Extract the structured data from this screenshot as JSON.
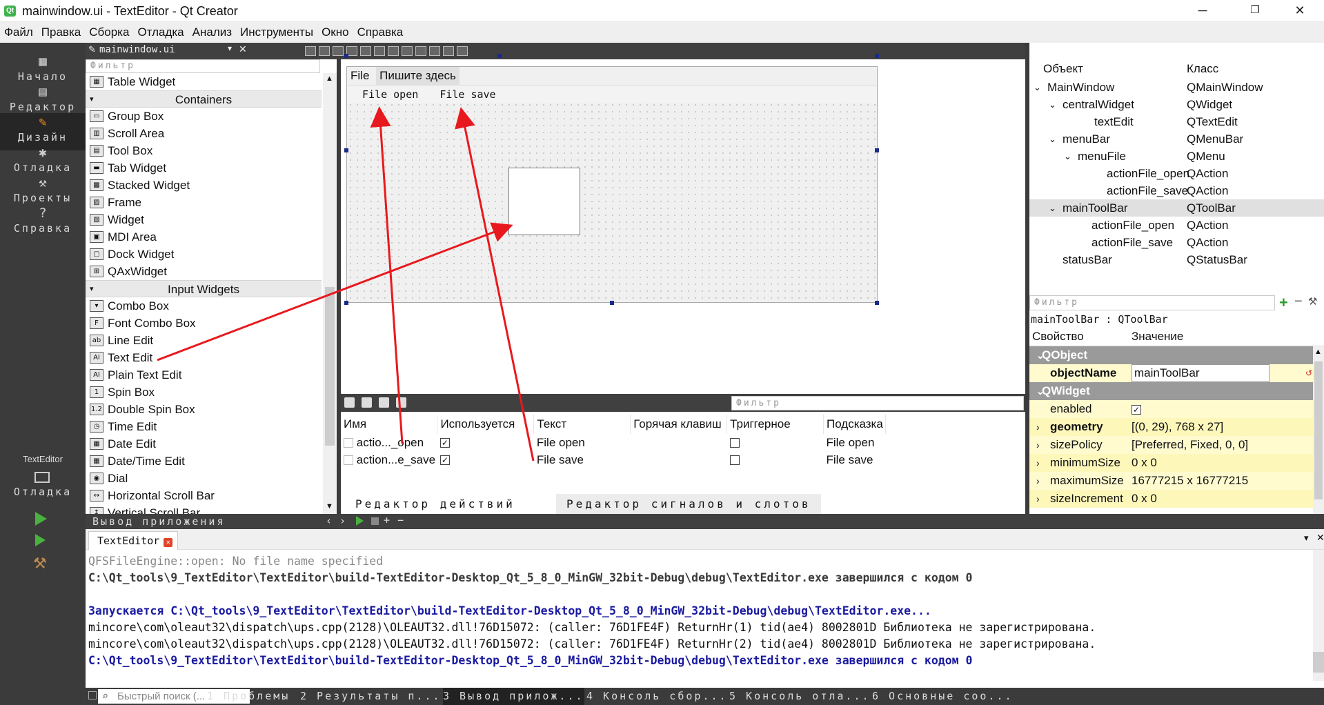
{
  "window": {
    "title": "mainwindow.ui - TextEditor - Qt Creator",
    "logo": "Qt",
    "minimize": "─",
    "maximize": "❐",
    "close": "✕"
  },
  "menubar": [
    "Файл",
    "Правка",
    "Сборка",
    "Отладка",
    "Анализ",
    "Инструменты",
    "Окно",
    "Справка"
  ],
  "modes": [
    {
      "label": "Начало",
      "icon": "grid-icon",
      "glyph": "▦"
    },
    {
      "label": "Редактор",
      "icon": "editor-icon",
      "glyph": "▤"
    },
    {
      "label": "Дизайн",
      "icon": "pencil-icon",
      "glyph": "✎",
      "active": true
    },
    {
      "label": "Отладка",
      "icon": "bug-icon",
      "glyph": "✱"
    },
    {
      "label": "Проекты",
      "icon": "wrench-icon",
      "glyph": "⚒"
    },
    {
      "label": "Справка",
      "icon": "help-icon",
      "glyph": "?"
    }
  ],
  "kit": {
    "project": "TextEditor",
    "mode": "Отладка"
  },
  "editor_tab": {
    "file": "mainwindow.ui"
  },
  "widgetbox": {
    "filter_placeholder": "Фильтр",
    "items": [
      {
        "type": "item",
        "label": "Table Widget",
        "glyph": "▦"
      },
      {
        "type": "cat",
        "label": "Containers"
      },
      {
        "type": "item",
        "label": "Group Box",
        "glyph": "▭"
      },
      {
        "type": "item",
        "label": "Scroll Area",
        "glyph": "▥"
      },
      {
        "type": "item",
        "label": "Tool Box",
        "glyph": "▤"
      },
      {
        "type": "item",
        "label": "Tab Widget",
        "glyph": "▬"
      },
      {
        "type": "item",
        "label": "Stacked Widget",
        "glyph": "▩"
      },
      {
        "type": "item",
        "label": "Frame",
        "glyph": "▨"
      },
      {
        "type": "item",
        "label": "Widget",
        "glyph": "▧"
      },
      {
        "type": "item",
        "label": "MDI Area",
        "glyph": "▣"
      },
      {
        "type": "item",
        "label": "Dock Widget",
        "glyph": "▢"
      },
      {
        "type": "item",
        "label": "QAxWidget",
        "glyph": "⊞"
      },
      {
        "type": "cat",
        "label": "Input Widgets"
      },
      {
        "type": "item",
        "label": "Combo Box",
        "glyph": "▾"
      },
      {
        "type": "item",
        "label": "Font Combo Box",
        "glyph": "F"
      },
      {
        "type": "item",
        "label": "Line Edit",
        "glyph": "ab"
      },
      {
        "type": "item",
        "label": "Text Edit",
        "glyph": "AI"
      },
      {
        "type": "item",
        "label": "Plain Text Edit",
        "glyph": "AI"
      },
      {
        "type": "item",
        "label": "Spin Box",
        "glyph": "1"
      },
      {
        "type": "item",
        "label": "Double Spin Box",
        "glyph": "1.2"
      },
      {
        "type": "item",
        "label": "Time Edit",
        "glyph": "◷"
      },
      {
        "type": "item",
        "label": "Date Edit",
        "glyph": "▦"
      },
      {
        "type": "item",
        "label": "Date/Time Edit",
        "glyph": "▦"
      },
      {
        "type": "item",
        "label": "Dial",
        "glyph": "◉"
      },
      {
        "type": "item",
        "label": "Horizontal Scroll Bar",
        "glyph": "↔"
      },
      {
        "type": "item",
        "label": "Vertical Scroll Bar",
        "glyph": "↕"
      }
    ]
  },
  "form": {
    "menu": [
      "File",
      "Пишите здесь"
    ],
    "toolbar": [
      "File open",
      "File save"
    ]
  },
  "action_editor": {
    "filter_placeholder": "Фильтр",
    "columns": [
      "Имя",
      "Используется",
      "Текст",
      "Горячая клавиш",
      "Триггерное",
      "Подсказка"
    ],
    "rows": [
      {
        "name": "actio..._open",
        "used": "✓",
        "text": "File open",
        "shortcut": "",
        "tooltip": "File open"
      },
      {
        "name": "action...e_save",
        "used": "✓",
        "text": "File save",
        "shortcut": "",
        "tooltip": "File save"
      }
    ],
    "tabs": [
      "Редактор действий",
      "Редактор сигналов и слотов"
    ]
  },
  "object_inspector": {
    "headers": [
      "Объект",
      "Класс"
    ],
    "rows": [
      {
        "obj": "MainWindow",
        "cls": "QMainWindow",
        "arrow": "⌄"
      },
      {
        "obj": "centralWidget",
        "cls": "QWidget",
        "arrow": "⌄"
      },
      {
        "obj": "textEdit",
        "cls": "QTextEdit",
        "arrow": ""
      },
      {
        "obj": "menuBar",
        "cls": "QMenuBar",
        "arrow": "⌄"
      },
      {
        "obj": "menuFile",
        "cls": "QMenu",
        "arrow": "⌄"
      },
      {
        "obj": "actionFile_open",
        "cls": "QAction",
        "arrow": ""
      },
      {
        "obj": "actionFile_save",
        "cls": "QAction",
        "arrow": ""
      },
      {
        "obj": "mainToolBar",
        "cls": "QToolBar",
        "arrow": "⌄",
        "selected": true
      },
      {
        "obj": "actionFile_open",
        "cls": "QAction",
        "arrow": ""
      },
      {
        "obj": "actionFile_save",
        "cls": "QAction",
        "arrow": ""
      },
      {
        "obj": "statusBar",
        "cls": "QStatusBar",
        "arrow": ""
      }
    ]
  },
  "property_editor": {
    "filter_placeholder": "Фильтр",
    "plus": "+",
    "minus": "−",
    "info": "mainToolBar : QToolBar",
    "headers": [
      "Свойство",
      "Значение"
    ],
    "rows": [
      {
        "kind": "grp",
        "name": "QObject",
        "arrow": "⌄"
      },
      {
        "kind": "edit",
        "name": "objectName",
        "value": "mainToolBar"
      },
      {
        "kind": "grp",
        "name": "QWidget",
        "arrow": "⌄"
      },
      {
        "kind": "check",
        "name": "enabled",
        "value": "✓"
      },
      {
        "kind": "val",
        "name": "geometry",
        "value": "[(0, 29), 768 x 27]",
        "arrow": "›",
        "bold": true
      },
      {
        "kind": "val",
        "name": "sizePolicy",
        "value": "[Preferred, Fixed, 0, 0]",
        "arrow": "›"
      },
      {
        "kind": "val",
        "name": "minimumSize",
        "value": "0 x 0",
        "arrow": "›"
      },
      {
        "kind": "val",
        "name": "maximumSize",
        "value": "16777215 x 16777215",
        "arrow": "›"
      },
      {
        "kind": "val",
        "name": "sizeIncrement",
        "value": "0 x 0",
        "arrow": "›"
      }
    ]
  },
  "output_pane": {
    "title": "Вывод приложения",
    "tab": "TextEditor",
    "tab_close": "✕",
    "lines": [
      {
        "style": "gray",
        "text": "QFSFileEngine::open: No file name specified"
      },
      {
        "style": "bold",
        "text": "C:\\Qt_tools\\9_TextEditor\\TextEditor\\build-TextEditor-Desktop_Qt_5_8_0_MinGW_32bit-Debug\\debug\\TextEditor.exe завершился с кодом 0"
      },
      {
        "style": "plain",
        "text": ""
      },
      {
        "style": "blue",
        "text": "Запускается C:\\Qt_tools\\9_TextEditor\\TextEditor\\build-TextEditor-Desktop_Qt_5_8_0_MinGW_32bit-Debug\\debug\\TextEditor.exe..."
      },
      {
        "style": "plain",
        "text": "mincore\\com\\oleaut32\\dispatch\\ups.cpp(2128)\\OLEAUT32.dll!76D15072: (caller: 76D1FE4F) ReturnHr(1) tid(ae4) 8002801D Библиотека не зарегистрирована."
      },
      {
        "style": "plain",
        "text": "mincore\\com\\oleaut32\\dispatch\\ups.cpp(2128)\\OLEAUT32.dll!76D15072: (caller: 76D1FE4F) ReturnHr(2) tid(ae4) 8002801D Библиотека не зарегистрирована."
      },
      {
        "style": "blue",
        "text": "C:\\Qt_tools\\9_TextEditor\\TextEditor\\build-TextEditor-Desktop_Qt_5_8_0_MinGW_32bit-Debug\\debug\\TextEditor.exe завершился с кодом 0"
      }
    ]
  },
  "statusbar": {
    "search_placeholder": "Быстрый поиск (...",
    "panes": [
      "1 Проблемы",
      "2 Результаты п...",
      "3 Вывод прилож...",
      "4 Консоль сбор...",
      "5 Консоль отла...",
      "6 Основные соо..."
    ]
  },
  "annotation_color": "#e8191e"
}
